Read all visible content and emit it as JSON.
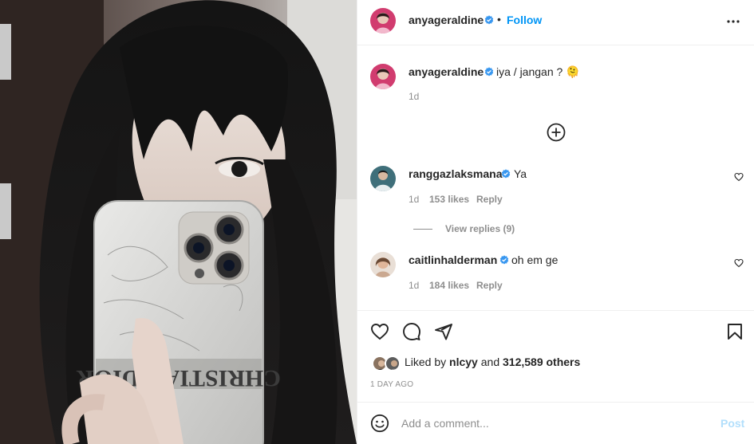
{
  "post": {
    "author": "anyageraldine",
    "follow_label": "Follow",
    "dot": "•",
    "caption": {
      "username": "anyageraldine",
      "text": "iya / jangan ? 🫠",
      "age": "1d"
    }
  },
  "comments": [
    {
      "username": "ranggazlaksmana",
      "verified": true,
      "text": "Ya",
      "age": "1d",
      "likes": "153 likes",
      "reply_label": "Reply",
      "view_replies": "View replies (9)"
    },
    {
      "username": "caitlinhalderman",
      "verified": true,
      "text": "oh em ge",
      "age": "1d",
      "likes": "184 likes",
      "reply_label": "Reply"
    }
  ],
  "likes_summary": {
    "prefix": "Liked by",
    "user": "nlcyy",
    "and": "and",
    "others": "312,589 others"
  },
  "posted_ago": "1 DAY AGO",
  "comment_box": {
    "placeholder": "Add a comment...",
    "post_label": "Post"
  },
  "colors": {
    "accent": "#0095f6",
    "accent_disabled": "#b2dffc",
    "verified": "#3897f0",
    "text": "#262626",
    "muted": "#8e8e8e"
  },
  "icons": [
    "more-options-icon",
    "load-more-icon",
    "heart-icon",
    "comment-icon",
    "share-icon",
    "bookmark-icon",
    "emoji-icon",
    "verified-badge-icon"
  ]
}
